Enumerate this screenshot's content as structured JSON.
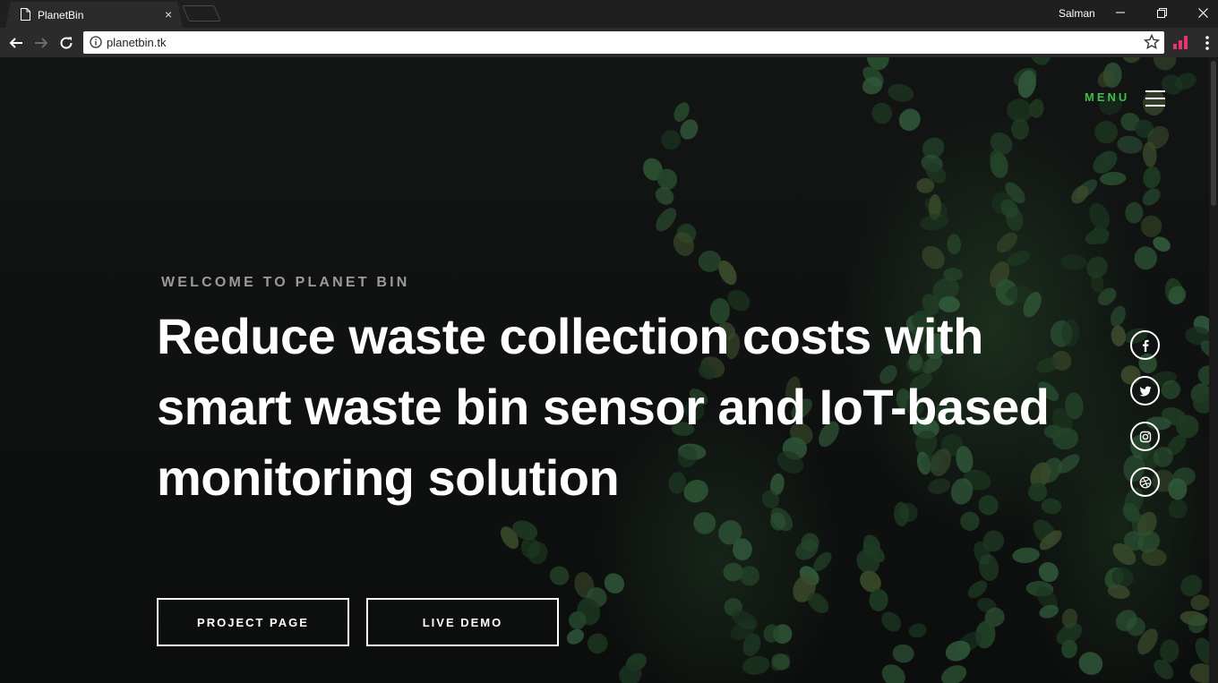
{
  "browser": {
    "tab_title": "PlanetBin",
    "close_symbol": "×",
    "profile_name": "Salman",
    "url": "planetbin.tk",
    "extension_color": "#e8336f"
  },
  "page": {
    "menu_label": "MENU",
    "welcome": "WELCOME TO PLANET BIN",
    "headline": "Reduce waste collection costs with smart waste bin sensor and IoT-based monitoring solution",
    "buttons": {
      "project": "PROJECT PAGE",
      "demo": "LIVE DEMO"
    },
    "social_icons": [
      "facebook-icon",
      "twitter-icon",
      "instagram-icon",
      "dribbble-icon"
    ],
    "accent_color": "#3dbf4a"
  }
}
